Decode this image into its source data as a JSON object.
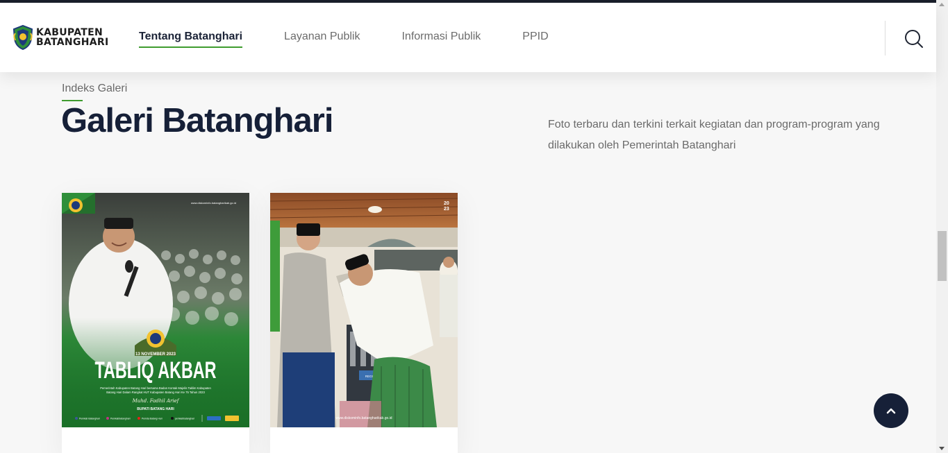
{
  "header": {
    "logo_line1": "KABUPATEN",
    "logo_line2": "BATANGHARI",
    "nav": [
      {
        "label": "Tentang Batanghari",
        "active": true
      },
      {
        "label": "Layanan Publik",
        "active": false
      },
      {
        "label": "Informasi Publik",
        "active": false
      },
      {
        "label": "PPID",
        "active": false
      }
    ],
    "search_icon": "search-icon"
  },
  "section": {
    "eyebrow": "Indeks Galeri",
    "title": "Galeri Batanghari",
    "description": "Foto terbaru dan terkini terkait kegiatan dan program-program yang dilakukan oleh Pemerintah Batanghari"
  },
  "cards": [
    {
      "url": "www.diskominfo.batangharikab.go.id",
      "date": "13 NOVEMBER 2023",
      "headline": "TABLIQ AKBAR",
      "caption1": "Pemerintah Kabupaten Batang Hari bersama Badan Kontak Majelis Taklim Kabupaten",
      "caption2": "Batang Hari Dalam Rangkat HUT Kabupaten Batang Hari Ke 75 Tahun 2023",
      "signature": "Muhd. Fadhil Arief",
      "role": "BUPATI BATANG HARI",
      "socials": [
        "Pemkab Batanghari",
        "Pemkabbatanghari",
        "Pemda Batang Hari",
        "pemkabbatanghari"
      ]
    },
    {
      "year_top": "20",
      "year_bottom": "23",
      "url": "www.diskominfo.batangharikab.go.id",
      "sign": "REGENCY"
    }
  ],
  "colors": {
    "accent": "#3e9c2e",
    "navy": "#162038"
  },
  "back_to_top_icon": "chevron-up-icon"
}
